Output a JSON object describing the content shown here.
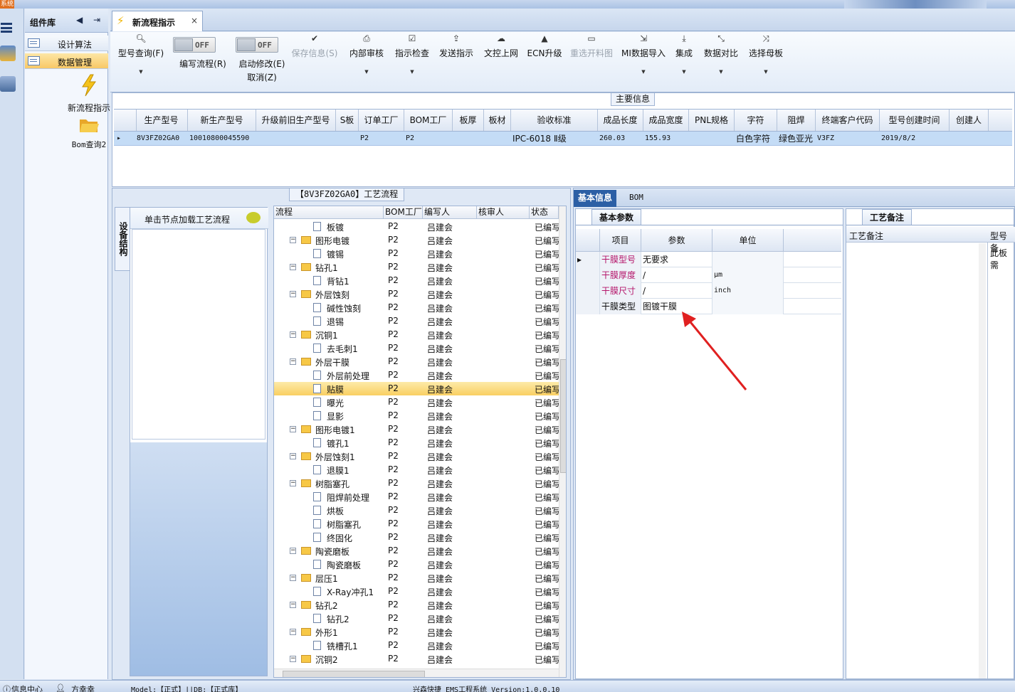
{
  "titlebar": {
    "system_label": "系统"
  },
  "sidebar": {
    "title": "组件库",
    "menu": [
      {
        "label": "设计算法"
      },
      {
        "label": "数据管理"
      }
    ],
    "tools": [
      {
        "label": "新流程指示",
        "icon": "lightning-icon"
      },
      {
        "label": "Bom查询2",
        "icon": "folder-open-icon"
      }
    ]
  },
  "tabs": [
    {
      "label": "新流程指示",
      "close": "×"
    }
  ],
  "ribbon": {
    "search": {
      "label": "型号查询(F)",
      "icon": "search-icon"
    },
    "toggle1": {
      "state": "OFF",
      "label": "编写流程(R)"
    },
    "toggle2": {
      "state": "OFF",
      "label": "启动修改(E)",
      "sub": "取消(Z)"
    },
    "buttons": [
      {
        "label": "保存信息(S)",
        "icon": "check-icon",
        "disabled": true
      },
      {
        "label": "内部审核",
        "icon": "printer-icon"
      },
      {
        "label": "指示检查",
        "icon": "checkbox-icon"
      },
      {
        "label": "发送指示",
        "icon": "upload-icon"
      },
      {
        "label": "文控上网",
        "icon": "cloud-upload-icon"
      },
      {
        "label": "ECN升级",
        "icon": "ecn-icon"
      },
      {
        "label": "重选开料图",
        "icon": "image-icon",
        "disabled": true
      },
      {
        "label": "MI数据导入",
        "icon": "import-icon"
      },
      {
        "label": "集成",
        "icon": "download-icon"
      },
      {
        "label": "数据对比",
        "icon": "compare-icon"
      },
      {
        "label": "选择母板",
        "icon": "shuffle-icon"
      }
    ]
  },
  "main_info": {
    "caption": "主要信息",
    "columns": [
      "生产型号",
      "新生产型号",
      "升级前旧生产型号",
      "S板",
      "订单工厂",
      "BOM工厂",
      "板厚",
      "板材",
      "验收标准",
      "成品长度",
      "成品宽度",
      "PNL规格",
      "字符",
      "阻焊",
      "终端客户代码",
      "型号创建时间",
      "创建人"
    ],
    "row": [
      "8V3FZ02GA0",
      "10010800045590",
      "",
      "",
      "P2",
      "P2",
      "",
      "",
      "IPC-6018 Ⅱ级",
      "260.03",
      "155.93",
      "",
      "白色字符",
      "绿色亚光",
      "V3FZ",
      "2019/8/2",
      ""
    ]
  },
  "process": {
    "caption": "【8V3FZ02GA0】工艺流程",
    "vertical_tab": "设备结构",
    "hint": "单击节点加载工艺流程",
    "columns": [
      "流程",
      "BOM工厂",
      "编写人",
      "核审人",
      "状态"
    ],
    "rows": [
      {
        "name": "板镀",
        "level": 2,
        "f": "P2",
        "w": "吕建会",
        "s": "已编写"
      },
      {
        "name": "图形电镀",
        "level": 1,
        "f": "P2",
        "w": "吕建会",
        "s": "已编写"
      },
      {
        "name": "镀锡",
        "level": 2,
        "f": "P2",
        "w": "吕建会",
        "s": "已编写"
      },
      {
        "name": "钻孔1",
        "level": 1,
        "f": "P2",
        "w": "吕建会",
        "s": "已编写"
      },
      {
        "name": "背钻1",
        "level": 2,
        "f": "P2",
        "w": "吕建会",
        "s": "已编写"
      },
      {
        "name": "外层蚀刻",
        "level": 1,
        "f": "P2",
        "w": "吕建会",
        "s": "已编写"
      },
      {
        "name": "碱性蚀刻",
        "level": 2,
        "f": "P2",
        "w": "吕建会",
        "s": "已编写"
      },
      {
        "name": "退锡",
        "level": 2,
        "f": "P2",
        "w": "吕建会",
        "s": "已编写"
      },
      {
        "name": "沉铜1",
        "level": 1,
        "f": "P2",
        "w": "吕建会",
        "s": "已编写"
      },
      {
        "name": "去毛刺1",
        "level": 2,
        "f": "P2",
        "w": "吕建会",
        "s": "已编写"
      },
      {
        "name": "外层干膜",
        "level": 1,
        "f": "P2",
        "w": "吕建会",
        "s": "已编写"
      },
      {
        "name": "外层前处理",
        "level": 2,
        "f": "P2",
        "w": "吕建会",
        "s": "已编写"
      },
      {
        "name": "贴膜",
        "level": 2,
        "f": "P2",
        "w": "吕建会",
        "s": "已编写",
        "selected": true
      },
      {
        "name": "曝光",
        "level": 2,
        "f": "P2",
        "w": "吕建会",
        "s": "已编写"
      },
      {
        "name": "显影",
        "level": 2,
        "f": "P2",
        "w": "吕建会",
        "s": "已编写"
      },
      {
        "name": "图形电镀1",
        "level": 1,
        "f": "P2",
        "w": "吕建会",
        "s": "已编写"
      },
      {
        "name": "镀孔1",
        "level": 2,
        "f": "P2",
        "w": "吕建会",
        "s": "已编写"
      },
      {
        "name": "外层蚀刻1",
        "level": 1,
        "f": "P2",
        "w": "吕建会",
        "s": "已编写"
      },
      {
        "name": "退膜1",
        "level": 2,
        "f": "P2",
        "w": "吕建会",
        "s": "已编写"
      },
      {
        "name": "树脂塞孔",
        "level": 1,
        "f": "P2",
        "w": "吕建会",
        "s": "已编写"
      },
      {
        "name": "阻焊前处理",
        "level": 2,
        "f": "P2",
        "w": "吕建会",
        "s": "已编写"
      },
      {
        "name": "烘板",
        "level": 2,
        "f": "P2",
        "w": "吕建会",
        "s": "已编写"
      },
      {
        "name": "树脂塞孔",
        "level": 2,
        "f": "P2",
        "w": "吕建会",
        "s": "已编写"
      },
      {
        "name": "终固化",
        "level": 2,
        "f": "P2",
        "w": "吕建会",
        "s": "已编写"
      },
      {
        "name": "陶瓷磨板",
        "level": 1,
        "f": "P2",
        "w": "吕建会",
        "s": "已编写"
      },
      {
        "name": "陶瓷磨板",
        "level": 2,
        "f": "P2",
        "w": "吕建会",
        "s": "已编写"
      },
      {
        "name": "层压1",
        "level": 1,
        "f": "P2",
        "w": "吕建会",
        "s": "已编写"
      },
      {
        "name": "X-Ray冲孔1",
        "level": 2,
        "f": "P2",
        "w": "吕建会",
        "s": "已编写"
      },
      {
        "name": "钻孔2",
        "level": 1,
        "f": "P2",
        "w": "吕建会",
        "s": "已编写"
      },
      {
        "name": "钻孔2",
        "level": 2,
        "f": "P2",
        "w": "吕建会",
        "s": "已编写"
      },
      {
        "name": "外形1",
        "level": 1,
        "f": "P2",
        "w": "吕建会",
        "s": "已编写"
      },
      {
        "name": "铣槽孔1",
        "level": 2,
        "f": "P2",
        "w": "吕建会",
        "s": "已编写"
      },
      {
        "name": "沉铜2",
        "level": 1,
        "f": "P2",
        "w": "吕建会",
        "s": "已编写"
      }
    ]
  },
  "info": {
    "tabs": [
      "基本信息",
      "BOM"
    ],
    "basic_caption": "基本参数",
    "columns": [
      "项目",
      "参数",
      "单位"
    ],
    "params": [
      {
        "item": "干膜型号",
        "value": "无要求",
        "unit": "",
        "highlight": true
      },
      {
        "item": "干膜厚度",
        "value": "/",
        "unit": "μm",
        "highlight": true
      },
      {
        "item": "干膜尺寸",
        "value": "/",
        "unit": "inch",
        "highlight": true
      },
      {
        "item": "干膜类型",
        "value": "图镀干膜",
        "unit": "",
        "highlight": false
      }
    ],
    "remarks_caption": "工艺备注",
    "remarks_columns": [
      "工艺备注",
      "型号备"
    ],
    "remarks_text": "此板需"
  },
  "status": {
    "info_center": "信息中心",
    "user": "方幸幸",
    "model": "Model:【正式】||DB:【正式库】",
    "app": "兴森快捷 EMS工程系统 Version:1.0.0.10"
  },
  "colors": {
    "accent": "#2c5fa5",
    "selected_row": "#f9cf62",
    "highlight_text": "#b5176b",
    "arrow": "#e02020"
  }
}
